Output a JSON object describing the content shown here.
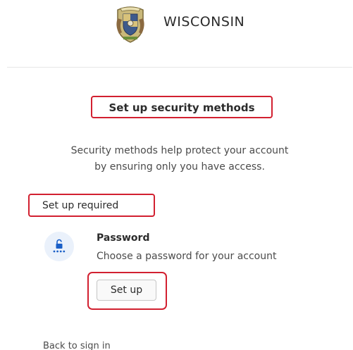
{
  "header": {
    "logo_icon": "wisconsin-state-seal-icon",
    "title": "WISCONSIN"
  },
  "main": {
    "page_title": "Set up security methods",
    "description_line1": "Security methods help protect your account",
    "description_line2": "by ensuring only you have access.",
    "section_label": "Set up required",
    "methods": [
      {
        "icon": "password-lock-icon",
        "name": "Password",
        "description": "Choose a password for your account",
        "button_label": "Set up"
      }
    ],
    "back_link": "Back to sign in"
  },
  "colors": {
    "highlight_border": "#d22030",
    "icon_background": "#eaf1fb",
    "icon_accent": "#1a5fc7"
  }
}
